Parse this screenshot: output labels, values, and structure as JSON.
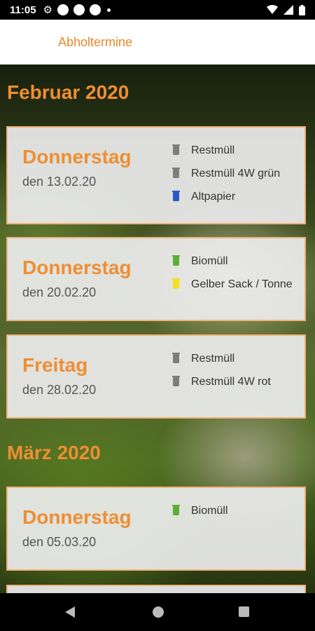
{
  "status_bar": {
    "time": "11:05"
  },
  "app_bar": {
    "title": "Abholtermine"
  },
  "months": [
    {
      "label": "Februar 2020",
      "entries": [
        {
          "day": "Donnerstag",
          "date": "den 13.02.20",
          "items": [
            {
              "label": "Restmüll",
              "bin_color": "#7d7d7d",
              "icon": "grey-bin-icon"
            },
            {
              "label": "Restmüll 4W grün",
              "bin_color": "#7d7d7d",
              "icon": "grey-bin-icon"
            },
            {
              "label": "Altpapier",
              "bin_color": "#2a58c8",
              "icon": "blue-bin-icon"
            }
          ]
        },
        {
          "day": "Donnerstag",
          "date": "den 20.02.20",
          "items": [
            {
              "label": "Biomüll",
              "bin_color": "#5ab035",
              "icon": "green-bin-icon"
            },
            {
              "label": "Gelber Sack / Tonne",
              "bin_color": "#f4e01c",
              "icon": "yellow-bin-icon"
            }
          ]
        },
        {
          "day": "Freitag",
          "date": "den 28.02.20",
          "items": [
            {
              "label": "Restmüll",
              "bin_color": "#7d7d7d",
              "icon": "grey-bin-icon"
            },
            {
              "label": "Restmüll 4W rot",
              "bin_color": "#7d7d7d",
              "icon": "grey-bin-icon"
            }
          ]
        }
      ]
    },
    {
      "label": "März 2020",
      "entries": [
        {
          "day": "Donnerstag",
          "date": "den 05.03.20",
          "items": [
            {
              "label": "Biomüll",
              "bin_color": "#5ab035",
              "icon": "green-bin-icon"
            }
          ]
        }
      ]
    }
  ],
  "colors": {
    "accent": "#ee8e33",
    "card_border": "#f0b27a"
  }
}
